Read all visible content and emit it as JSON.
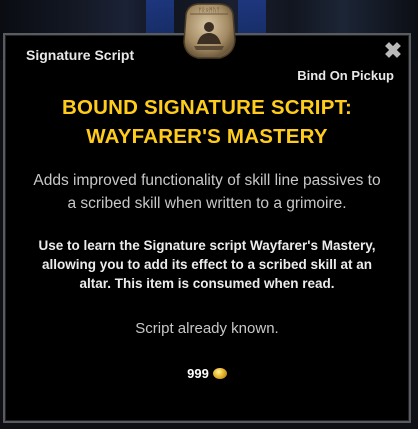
{
  "tooltip": {
    "item_type": "Signature Script",
    "bind_type": "Bind On Pickup",
    "title_line1": "BOUND SIGNATURE SCRIPT:",
    "title_line2": "WAYFARER'S MASTERY",
    "description": "Adds improved functionality of skill line passives to a scribed skill when written to a grimoire.",
    "use_text": "Use to learn the Signature script Wayfarer's Mastery, allowing you to add its effect to a scribed skill at an altar. This item is consumed when read.",
    "known_text": "Script already known.",
    "price": "999",
    "close_glyph": "✖",
    "icons": {
      "emblem": "scroll-emblem-icon",
      "close": "close-icon",
      "currency": "gold-coin-icon"
    },
    "colors": {
      "title": "#ffcc1c",
      "border": "#5a5b5e",
      "background": "#000000"
    }
  }
}
